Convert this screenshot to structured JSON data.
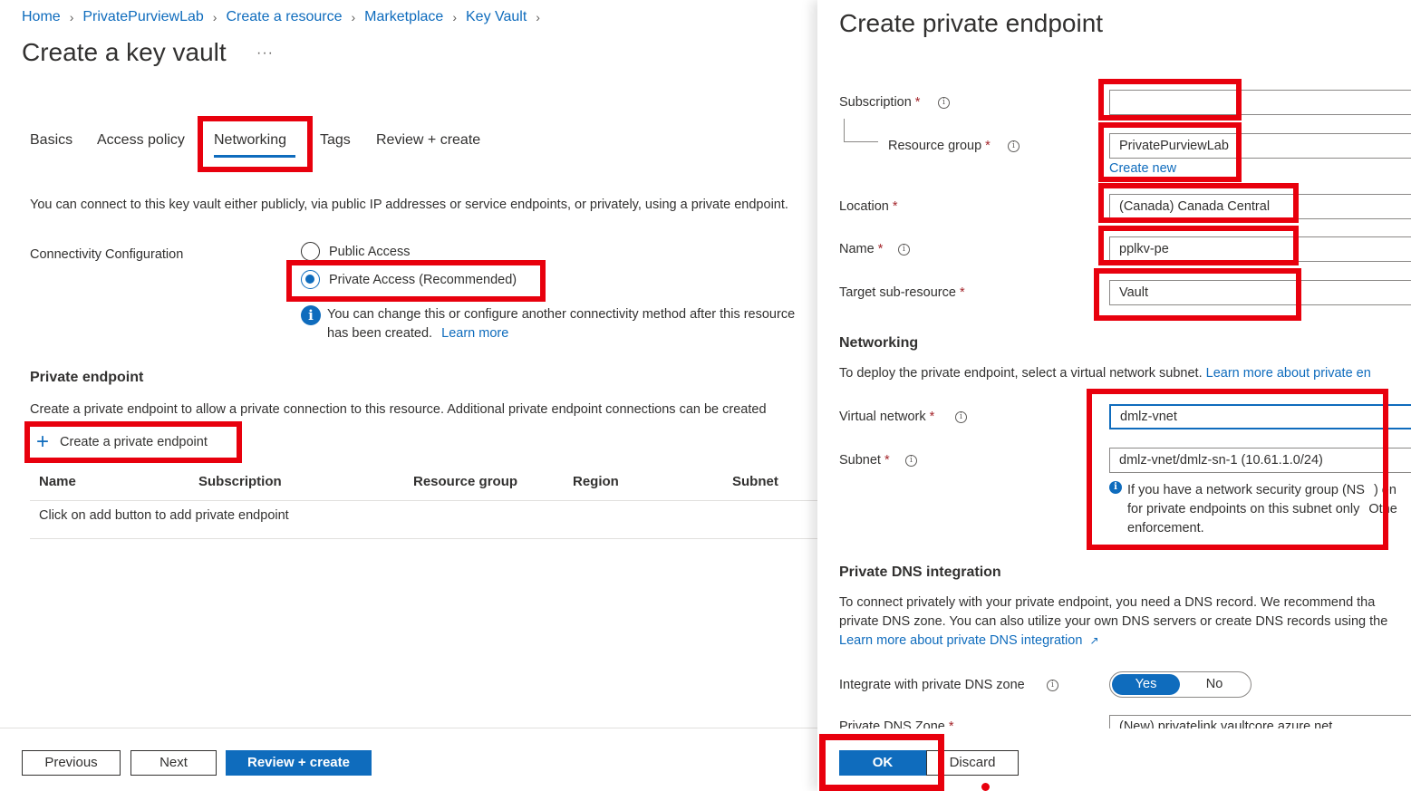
{
  "breadcrumb": [
    "Home",
    "PrivatePurviewLab",
    "Create a resource",
    "Marketplace",
    "Key Vault"
  ],
  "page_title": "Create a key vault",
  "more_label": "···",
  "tabs": [
    "Basics",
    "Access policy",
    "Networking",
    "Tags",
    "Review + create"
  ],
  "active_tab": "Networking",
  "networking": {
    "intro": "You can connect to this key vault either publicly, via public IP addresses or service endpoints, or privately, using a private endpoint.",
    "connectivity_label": "Connectivity Configuration",
    "option_public": "Public Access",
    "option_private": "Private Access (Recommended)",
    "info_text": "You can change this or configure another connectivity method after this resource has been created.",
    "learn_more": "Learn more",
    "pe_heading": "Private endpoint",
    "pe_desc": "Create a private endpoint to allow a private connection to this resource. Additional private endpoint connections can be created",
    "create_pe_button": "Create a private endpoint",
    "table_headers": [
      "Name",
      "Subscription",
      "Resource group",
      "Region",
      "Subnet"
    ],
    "empty_row": "Click on add button to add private endpoint"
  },
  "footer": {
    "previous": "Previous",
    "next": "Next",
    "review_create": "Review + create"
  },
  "panel": {
    "title": "Create private endpoint",
    "subscription_label": "Subscription",
    "subscription_value": "",
    "resource_group_label": "Resource group",
    "resource_group_value": "PrivatePurviewLab",
    "create_new": "Create new",
    "location_label": "Location",
    "location_value": "(Canada) Canada Central",
    "name_label": "Name",
    "name_value": "pplkv-pe",
    "target_label": "Target sub-resource",
    "target_value": "Vault",
    "networking_heading": "Networking",
    "networking_desc": "To deploy the private endpoint, select a virtual network subnet.",
    "networking_link": "Learn more about private en",
    "vnet_label": "Virtual network",
    "vnet_value": "dmlz-vnet",
    "subnet_label": "Subnet",
    "subnet_value": "dmlz-vnet/dmlz-sn-1 (10.61.1.0/24)",
    "nsg_info_1": "If you have a network security group (NS",
    "nsg_info_1b": ") en",
    "nsg_info_2": "for private endpoints on this subnet only",
    "nsg_info_2b": "Othe",
    "nsg_info_3": "enforcement.",
    "dns_heading": "Private DNS integration",
    "dns_desc_1": "To connect privately with your private endpoint, you need a DNS record. We recommend tha",
    "dns_desc_2": "private DNS zone. You can also utilize your own DNS servers or create DNS records using the",
    "dns_link": "Learn more about private DNS integration",
    "integrate_label": "Integrate with private DNS zone",
    "toggle_yes": "Yes",
    "toggle_no": "No",
    "dns_zone_label": "Private DNS Zone",
    "dns_zone_value": "(New) privatelink.vaultcore.azure.net",
    "ok": "OK",
    "discard": "Discard"
  },
  "colors": {
    "accent": "#0f6cbd",
    "highlight": "#e8000d"
  }
}
